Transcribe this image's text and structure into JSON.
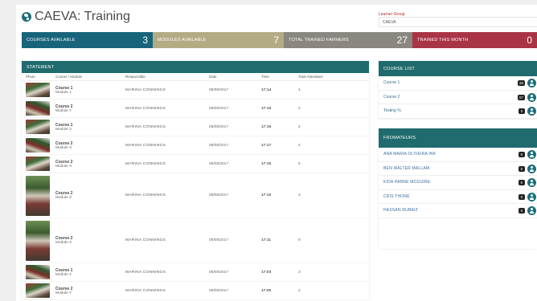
{
  "header": {
    "title": "CAEVA: Training"
  },
  "filter": {
    "label": "Learner Group",
    "value": "CAEVA"
  },
  "stats": [
    {
      "label": "COURSES AVAILABLE",
      "value": "3"
    },
    {
      "label": "MODULES AVAILABLE",
      "value": "7"
    },
    {
      "label": "TOTAL TRAINED FARMERS",
      "value": "27"
    },
    {
      "label": "TRAINED THIS MONTH",
      "value": "0"
    }
  ],
  "colors": {
    "teal": "#17647b",
    "khaki": "#b3ab84",
    "grey": "#8a8680",
    "crimson": "#a93446",
    "panel_header": "#1f6b6e"
  },
  "statement": {
    "title": "STATEMENT",
    "columns": {
      "photo": "Photo",
      "course": "Course / Module",
      "responsible": "Responsible",
      "date": "Date",
      "time": "Time",
      "attendees": "Total Attendees"
    },
    "rows": [
      {
        "course": "Course 1",
        "module": "Module 1",
        "responsible": "MARINA CONNINGS",
        "date": "08/08/2017",
        "time": "17:14",
        "attendees": "4"
      },
      {
        "course": "Course 2",
        "module": "Module Y",
        "responsible": "MARINA CONNINGS",
        "date": "08/08/2017",
        "time": "17:15",
        "attendees": "2"
      },
      {
        "course": "Course 1",
        "module": "Module 3",
        "responsible": "MARINA CONNINGS",
        "date": "08/08/2017",
        "time": "17:16",
        "attendees": "4"
      },
      {
        "course": "Course 2",
        "module": "Module X",
        "responsible": "MARINA CONNINGS",
        "date": "08/08/2017",
        "time": "17:17",
        "attendees": "4"
      },
      {
        "course": "Course 2",
        "module": "Module X",
        "responsible": "MARINA CONNINGS",
        "date": "08/08/2017",
        "time": "17:16",
        "attendees": "6"
      },
      {
        "course": "Course 2",
        "module": "Module Z",
        "responsible": "MARINA CONNINGS",
        "date": "08/08/2017",
        "time": "17:10",
        "attendees": "3"
      },
      {
        "course": "Course 2",
        "module": "Module X",
        "responsible": "MARINA CONNINGS",
        "date": "08/08/2017",
        "time": "17:11",
        "attendees": "9"
      },
      {
        "course": "Course 1",
        "module": "Module 2",
        "responsible": "MARINA CONNINGS",
        "date": "08/08/2017",
        "time": "17:03",
        "attendees": "3"
      },
      {
        "course": "Course 2",
        "module": "Module Y",
        "responsible": "MARINA CONNINGS",
        "date": "08/08/2017",
        "time": "17:00",
        "attendees": "2"
      }
    ]
  },
  "course_list": {
    "title": "COURSE LIST",
    "items": [
      {
        "label": "Course 1",
        "count": "26"
      },
      {
        "label": "Course 2",
        "count": "57"
      },
      {
        "label": "Testing %",
        "count": "0"
      }
    ]
  },
  "trainers": {
    "title": "FROMATEURS",
    "items": [
      {
        "label": "ANA MARIA OLIVEIRA INK",
        "count": "0"
      },
      {
        "label": "BEN WALTER MALLAM",
        "count": "0"
      },
      {
        "label": "KIDA PARNE MCGUIRE",
        "count": "0"
      },
      {
        "label": "CRIS THONE",
        "count": "0"
      },
      {
        "label": "HASSAN RUBAIZ",
        "count": "0"
      }
    ]
  }
}
